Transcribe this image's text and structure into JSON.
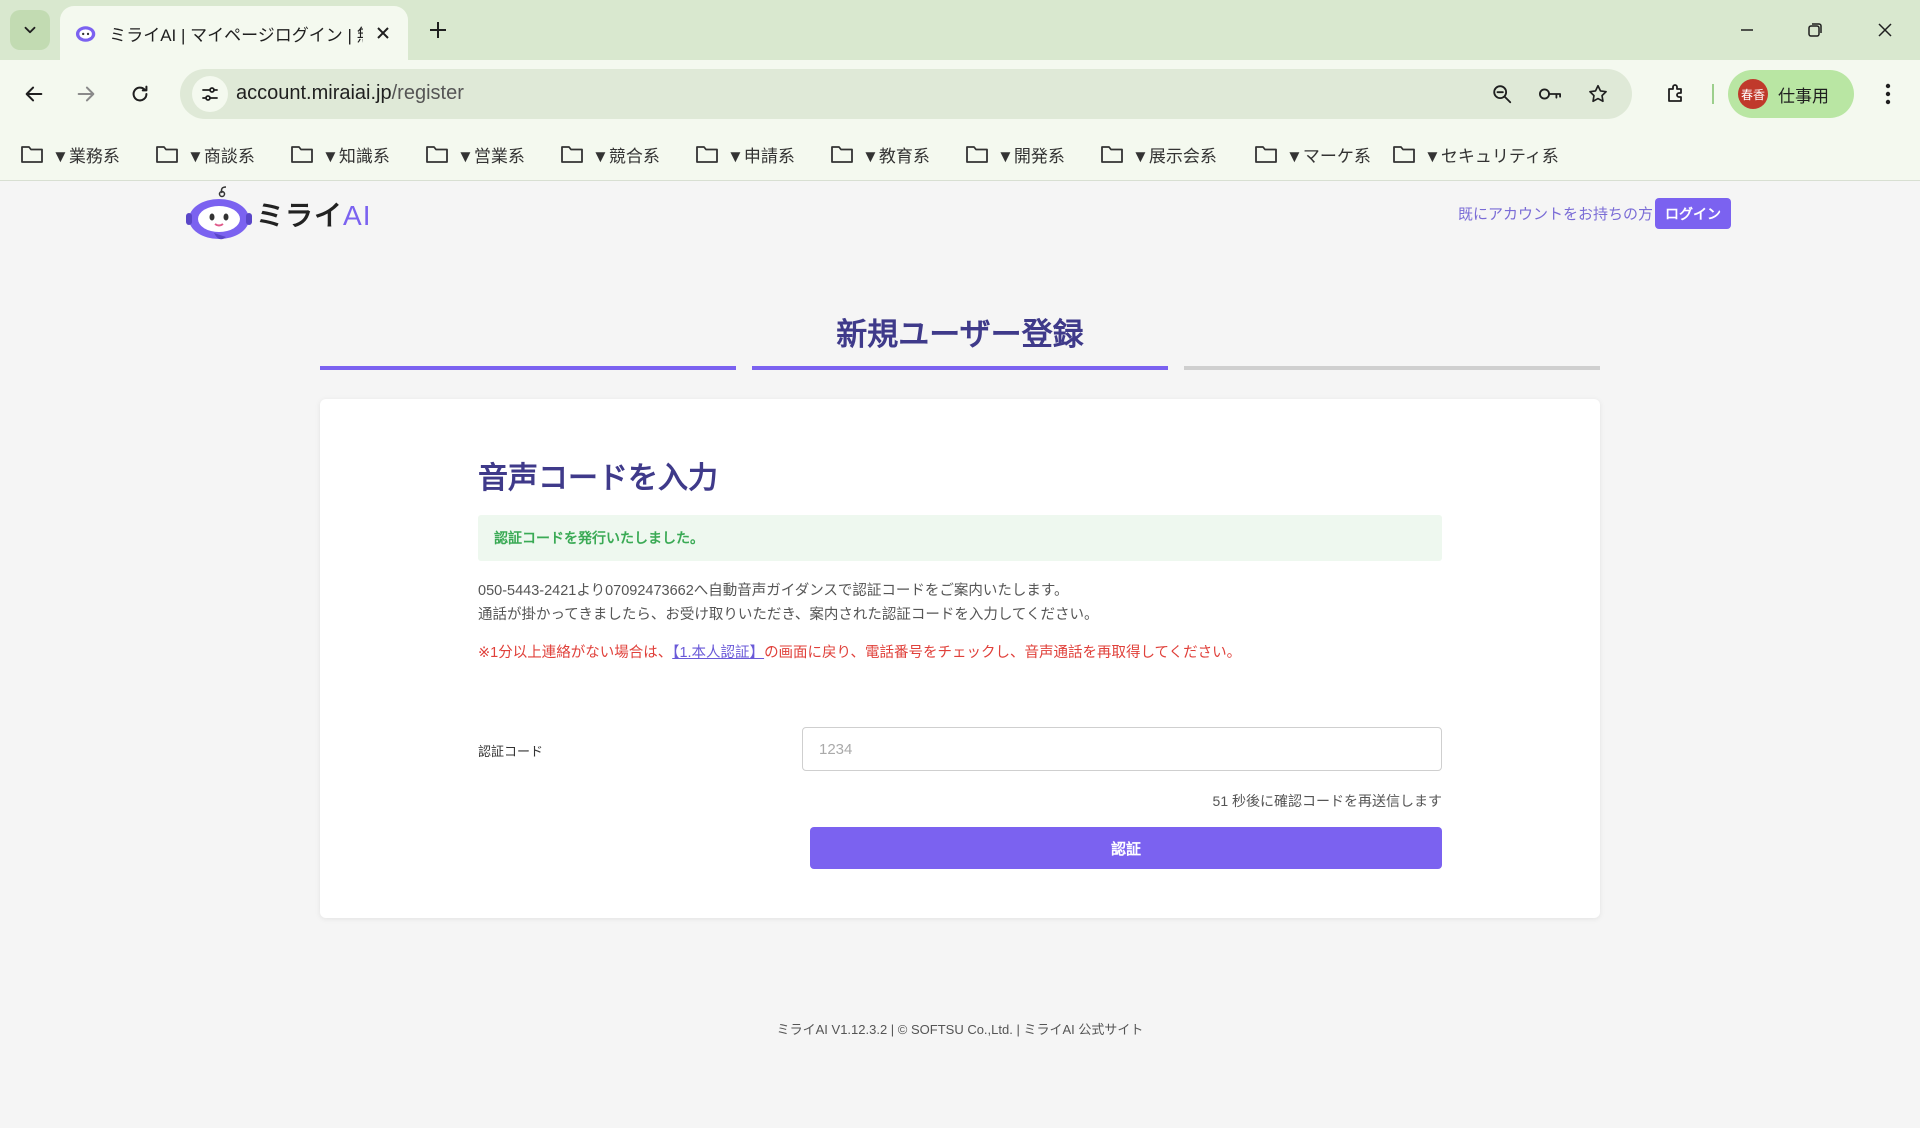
{
  "browser": {
    "tab_title": "ミライAI | マイページログイン | 無料テ",
    "url_domain": "account.miraiai.jp",
    "url_path": "/register",
    "profile_name": "仕事用",
    "profile_avatar": "春香",
    "bookmarks": [
      "▼業務系",
      "▼商談系",
      "▼知識系",
      "▼営業系",
      "▼競合系",
      "▼申請系",
      "▼教育系",
      "▼開発系",
      "▼展示会系",
      "▼マーケ系",
      "▼セキュリティ系"
    ]
  },
  "header": {
    "logo_main": "ミライ",
    "logo_ai": "AI",
    "have_account": "既にアカウントをお持ちの方",
    "login_label": "ログイン"
  },
  "page": {
    "title": "新規ユーザー登録",
    "steps": [
      {
        "state": "done",
        "color": "#7b62f0"
      },
      {
        "state": "active",
        "color": "#7b62f0"
      },
      {
        "state": "pending",
        "color": "#cfcfcf"
      }
    ]
  },
  "card": {
    "title": "音声コードを入力",
    "success_message": "認証コードを発行いたしました。",
    "desc_line1": "050-5443-2421より07092473662へ自動音声ガイダンスで認証コードをご案内いたします。",
    "desc_line2": "通話が掛かってきましたら、お受け取りいただき、案内された認証コードを入力してください。",
    "warn_before": "※1分以上連絡がない場合は、",
    "warn_link": "【1.本人認証】",
    "warn_after": "の画面に戻り、電話番号をチェックし、音声通話を再取得してください。",
    "field_label": "認証コード",
    "field_placeholder": "1234",
    "field_value": "",
    "resend_text": "51 秒後に確認コードを再送信します",
    "submit_label": "認証"
  },
  "footer": {
    "text": "ミライAI V1.12.3.2 | © SOFTSU Co.,Ltd. | ミライAI 公式サイト"
  },
  "colors": {
    "accent": "#7b62f0",
    "title": "#3f3a8a",
    "success_bg": "#eef8ef",
    "success_text": "#3aaa55",
    "warn": "#e0403a",
    "chrome_tabbar": "#d9e8cf"
  }
}
